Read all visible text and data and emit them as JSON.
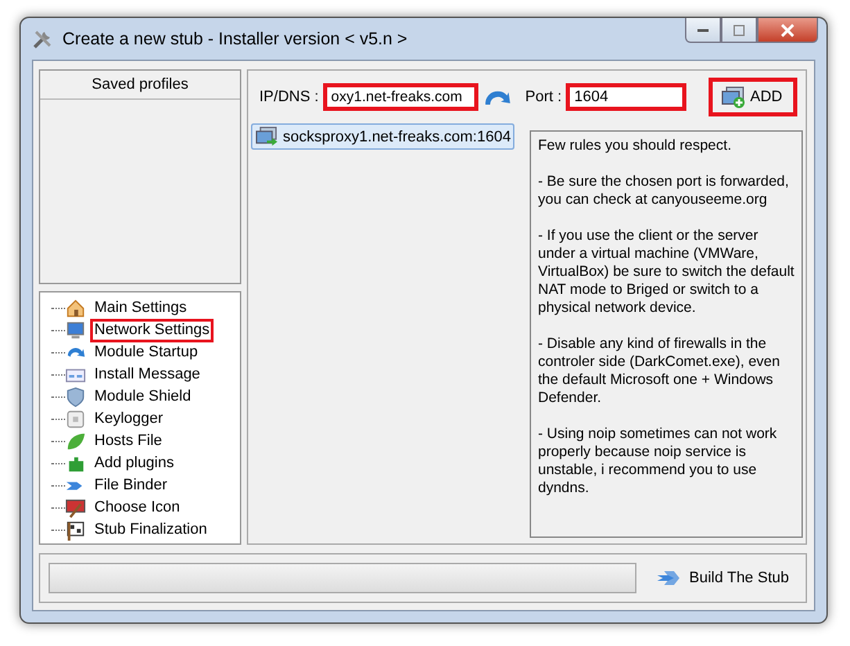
{
  "window": {
    "title": "Create a new stub - Installer version < v5.n >"
  },
  "saved_profiles": {
    "heading": "Saved profiles"
  },
  "nav_items": [
    {
      "label": "Main Settings",
      "selected": false
    },
    {
      "label": "Network Settings",
      "selected": true
    },
    {
      "label": "Module Startup",
      "selected": false
    },
    {
      "label": "Install Message",
      "selected": false
    },
    {
      "label": "Module Shield",
      "selected": false
    },
    {
      "label": "Keylogger",
      "selected": false
    },
    {
      "label": "Hosts File",
      "selected": false
    },
    {
      "label": "Add plugins",
      "selected": false
    },
    {
      "label": "File Binder",
      "selected": false
    },
    {
      "label": "Choose Icon",
      "selected": false
    },
    {
      "label": "Stub Finalization",
      "selected": false
    }
  ],
  "connection": {
    "ip_label": "IP/DNS :",
    "ip_value": "oxy1.net-freaks.com",
    "port_label": "Port :",
    "port_value": "1604",
    "add_button": "ADD"
  },
  "hosts": [
    {
      "label": "socksproxy1.net-freaks.com:1604",
      "selected": true
    }
  ],
  "rules": [
    "Few rules you should respect.",
    "- Be sure the chosen port is forwarded, you can check at canyouseeme.org",
    "- If you use the client or the server under a virtual machine (VMWare, VirtualBox) be sure to switch the default NAT mode to Briged or switch to a physical network device.",
    "- Disable any kind of firewalls in the controler side (DarkComet.exe), even the default Microsoft one + Windows Defender.",
    "- Using noip sometimes can not work properly because noip service is unstable, i recommend you to use dyndns."
  ],
  "footer": {
    "progress": {
      "level": 0
    },
    "build_button": "Build The Stub"
  }
}
